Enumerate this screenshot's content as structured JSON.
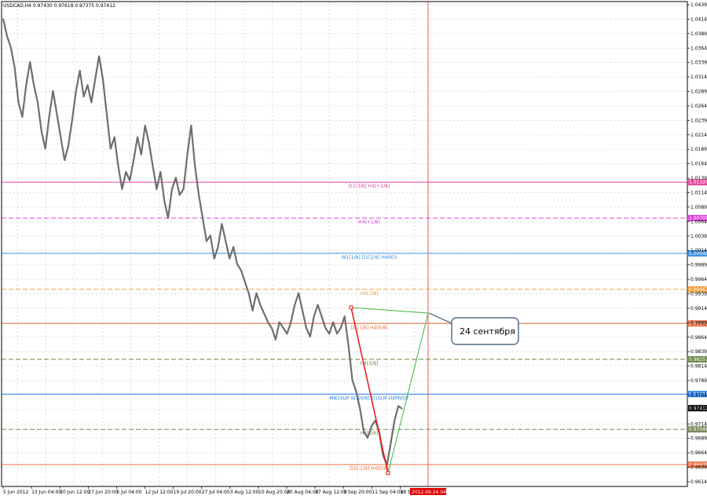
{
  "window": {
    "symbol_info": "USDCAD,H4  0.97430 0.97618 0.97375 0.97412"
  },
  "chart_data": {
    "type": "line",
    "title": "USDCAD,H4",
    "ohlc_last": {
      "open": 0.9743,
      "high": 0.97618,
      "low": 0.97375,
      "close": 0.97412
    },
    "ylim": [
      0.9614,
      1.0439
    ],
    "y_ticks": [
      "1.04390",
      "1.04140",
      "1.03890",
      "1.03640",
      "1.03390",
      "1.03140",
      "1.02890",
      "1.02640",
      "1.02390",
      "1.02140",
      "1.01890",
      "1.01640",
      "1.01390",
      "1.01140",
      "1.00890",
      "1.00640",
      "1.00390",
      "1.00140",
      "0.99890",
      "0.99640",
      "0.99390",
      "0.99140",
      "0.98890",
      "0.98640",
      "0.98390",
      "0.98140",
      "0.97890",
      "0.97640",
      "0.97390",
      "0.97140",
      "0.96890",
      "0.96640",
      "0.96390",
      "0.96140"
    ],
    "x_ticks": [
      "5 Jun 2012",
      "13 Jun 04:00",
      "20 Jun 12:00",
      "27 Jun 20:00",
      "5 Jul 04:00",
      "12 Jul 12:00",
      "19 Jul 20:00",
      "27 Jul 04:00",
      "3 Aug 12:00",
      "10 Aug 20:00",
      "20 Aug 04:00",
      "27 Aug 12:00",
      "3 Sep 20:00",
      "11 Sep 04:00",
      "18 Sep"
    ],
    "x_cursor_label": "2012.09.24 04:00",
    "price_label": "0.97412",
    "series": [
      {
        "values": [
          1.0415,
          1.0385,
          1.0365,
          1.033,
          1.027,
          1.0245,
          1.03,
          1.034,
          1.03,
          1.027,
          1.022,
          1.019,
          1.0245,
          1.029,
          1.025,
          1.021,
          1.017,
          1.0195,
          1.024,
          1.029,
          1.0325,
          1.028,
          1.03,
          1.027,
          1.031,
          1.035,
          1.031,
          1.025,
          1.019,
          1.021,
          1.016,
          1.012,
          1.015,
          1.0135,
          1.017,
          1.021,
          1.018,
          1.023,
          1.02,
          1.016,
          1.012,
          1.015,
          1.01,
          1.007,
          1.012,
          1.014,
          1.011,
          1.012,
          1.018,
          1.023,
          1.016,
          1.011,
          1.007,
          1.003,
          1.004,
          1.0,
          1.002,
          1.006,
          1.003,
          1.0,
          1.002,
          0.999,
          0.998,
          0.996,
          0.994,
          0.991,
          0.994,
          0.992,
          0.9905,
          0.989,
          0.988,
          0.986,
          0.989,
          0.988,
          0.987,
          0.989,
          0.992,
          0.994,
          0.991,
          0.988,
          0.9865,
          0.99,
          0.992,
          0.99,
          0.988,
          0.987,
          0.989,
          0.987,
          0.988,
          0.99,
          0.985,
          0.979,
          0.977,
          0.974,
          0.97,
          0.969,
          0.971,
          0.972,
          0.97,
          0.966,
          0.9643,
          0.968,
          0.972,
          0.9745,
          0.974
        ]
      }
    ],
    "levels": [
      {
        "label": "D1[3/8] H4[+2/8]",
        "price": 1.0132,
        "tag": "1.01320",
        "color": "#e8479a",
        "dash": false
      },
      {
        "label": "H4[+1/8]",
        "price": 1.007,
        "tag": "1.00700",
        "color": "#e040e0",
        "dash": true
      },
      {
        "label": "W1[1/8] D1[2/8] H4RES",
        "price": 1.0009,
        "tag": "1.00090",
        "color": "#3b8fe0",
        "dash": false
      },
      {
        "label": "H4[7/8]",
        "price": 0.99467,
        "tag": "0.99467",
        "color": "#f0a040",
        "dash": true
      },
      {
        "label": "D1[1/8] H4[6/8]",
        "price": 0.98877,
        "tag": "0.98877",
        "color": "#f07040",
        "dash": false
      },
      {
        "label": "H4[5/8]",
        "price": 0.98257,
        "tag": "0.98257",
        "color": "#6a8a4a",
        "dash": true
      },
      {
        "label": "MN1SUP W1[0/8] D1SUP H4PIVOT",
        "price": 0.97656,
        "tag": "0.97656",
        "color": "#2a80f0",
        "dash": false
      },
      {
        "label": "H4[3/8]",
        "price": 0.97046,
        "tag": "0.97046",
        "color": "#7a8a5a",
        "dash": true
      },
      {
        "label": "D1[-1/8] H4[0/8]",
        "price": 0.96436,
        "tag": "0.96436",
        "color": "#f07040",
        "dash": false
      }
    ],
    "annotation": "24 сентября",
    "grid": true
  }
}
